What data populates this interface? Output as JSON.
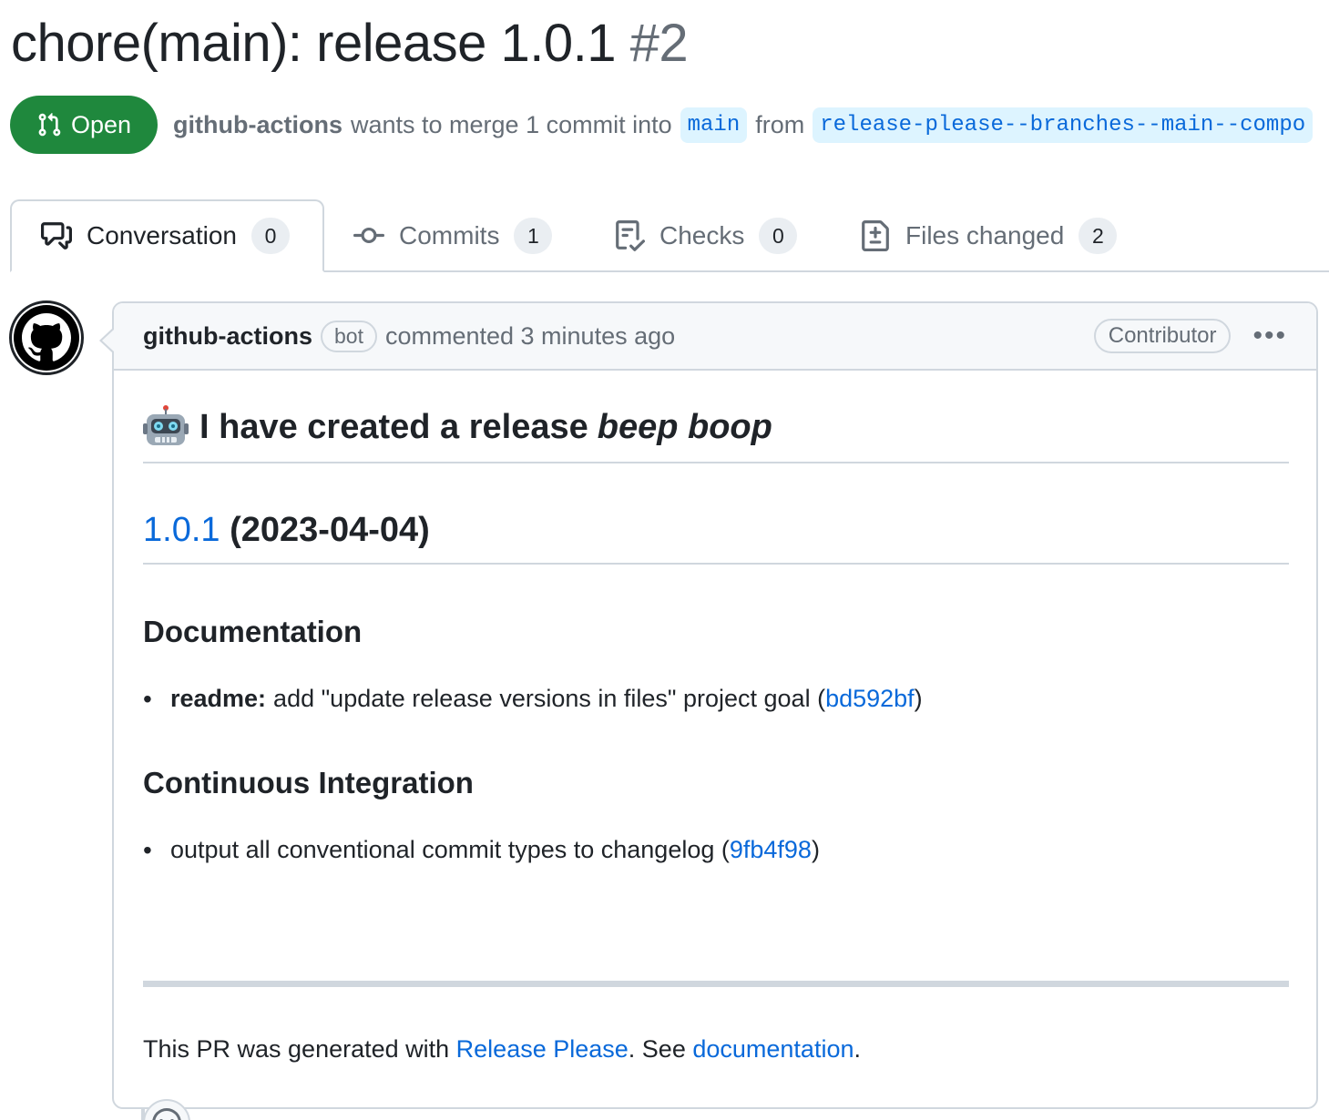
{
  "pr": {
    "title": "chore(main): release 1.0.1",
    "number": "#2",
    "state": "Open",
    "author": "github-actions",
    "merge_text_1": "wants to merge 1 commit into",
    "base_branch": "main",
    "merge_text_2": "from",
    "head_branch": "release-please--branches--main--compo"
  },
  "tabs": [
    {
      "label": "Conversation",
      "count": "0",
      "icon": "comment-discussion-icon"
    },
    {
      "label": "Commits",
      "count": "1",
      "icon": "git-commit-icon"
    },
    {
      "label": "Checks",
      "count": "0",
      "icon": "checklist-icon"
    },
    {
      "label": "Files changed",
      "count": "2",
      "icon": "file-diff-icon"
    }
  ],
  "comment": {
    "author": "github-actions",
    "bot_label": "bot",
    "timestamp": "commented 3 minutes ago",
    "role": "Contributor",
    "heading_plain": "I have created a release",
    "heading_italic": "beep boop",
    "version_link": "1.0.1",
    "version_date": "(2023-04-04)",
    "sections": [
      {
        "title": "Documentation",
        "items": [
          {
            "scope": "readme:",
            "text": "add \"update release versions in files\" project goal (",
            "hash": "bd592bf",
            "close": ")"
          }
        ]
      },
      {
        "title": "Continuous Integration",
        "items": [
          {
            "scope": "",
            "text": "output all conventional commit types to changelog (",
            "hash": "9fb4f98",
            "close": ")"
          }
        ]
      }
    ],
    "footer": {
      "prefix": "This PR was generated with",
      "link1": "Release Please",
      "middle": ". See",
      "link2": "documentation",
      "suffix": "."
    }
  },
  "colors": {
    "open_green": "#1f883d",
    "link_blue": "#0969da",
    "branch_bg": "#ddf4ff",
    "muted": "#656d76",
    "border": "#d0d7de"
  }
}
